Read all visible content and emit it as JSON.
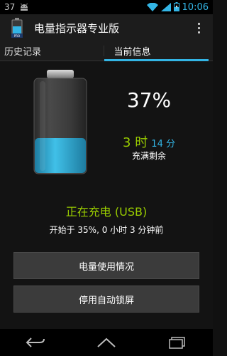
{
  "status_bar": {
    "notification_count": "37",
    "time": "10:06",
    "icons": [
      "android-icon",
      "wifi-icon",
      "signal-icon",
      "battery-charging-icon"
    ]
  },
  "action_bar": {
    "title": "电量指示器专业版",
    "app_icon": "battery-app-icon",
    "overflow_icon": "overflow-menu-icon"
  },
  "tabs": [
    {
      "label": "历史记录",
      "active": false
    },
    {
      "label": "当前信息",
      "active": true
    }
  ],
  "battery": {
    "level": 0.37,
    "percent_text": "37%",
    "hours_text": "3 时",
    "minutes_text": "14 分",
    "remaining_label": "充满剩余"
  },
  "charging": {
    "status": "正在充电 (USB)",
    "since": "开始于 35%, 0 小时 3 分钟前"
  },
  "buttons": {
    "usage": "电量使用情况",
    "lock": "停用自动锁屏"
  },
  "nav_bar": {
    "icons": [
      "back-icon",
      "home-icon",
      "recent-apps-icon"
    ]
  },
  "colors": {
    "accent_blue": "#33b5e5",
    "accent_green": "#99cc00",
    "background": "#131313"
  }
}
